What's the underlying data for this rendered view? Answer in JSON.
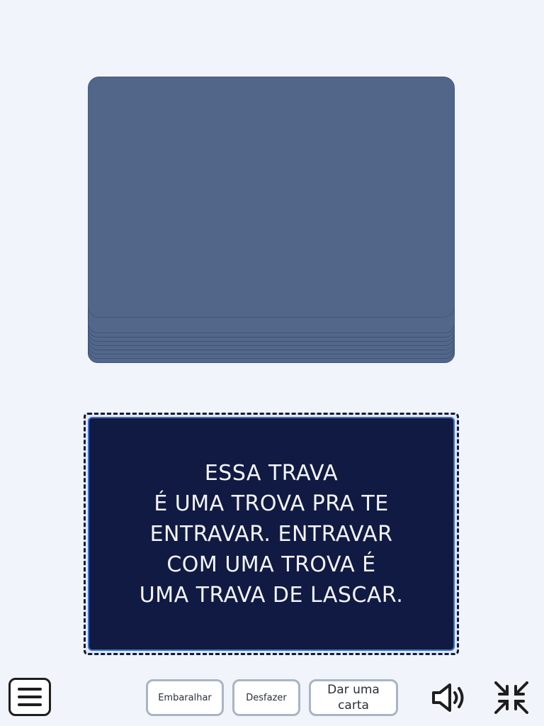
{
  "deck": {
    "stacked_cards": 8
  },
  "card": {
    "lines": [
      "ESSA TRAVA",
      "É UMA TROVA PRA TE",
      "ENTRAVAR. ENTRAVAR",
      "COM UMA TROVA É",
      "UMA TRAVA DE LASCAR."
    ]
  },
  "toolbar": {
    "shuffle_label": "Embaralhar",
    "undo_label": "Desfazer",
    "deal_label": "Dar uma carta",
    "menu_icon": "hamburger-menu-icon",
    "sound_icon": "speaker-icon",
    "fullscreen_icon": "exit-fullscreen-icon"
  },
  "colors": {
    "background": "#f1f5fb",
    "deck": "#52668a",
    "card": "#111a42",
    "card_text": "#f3f5fa"
  }
}
